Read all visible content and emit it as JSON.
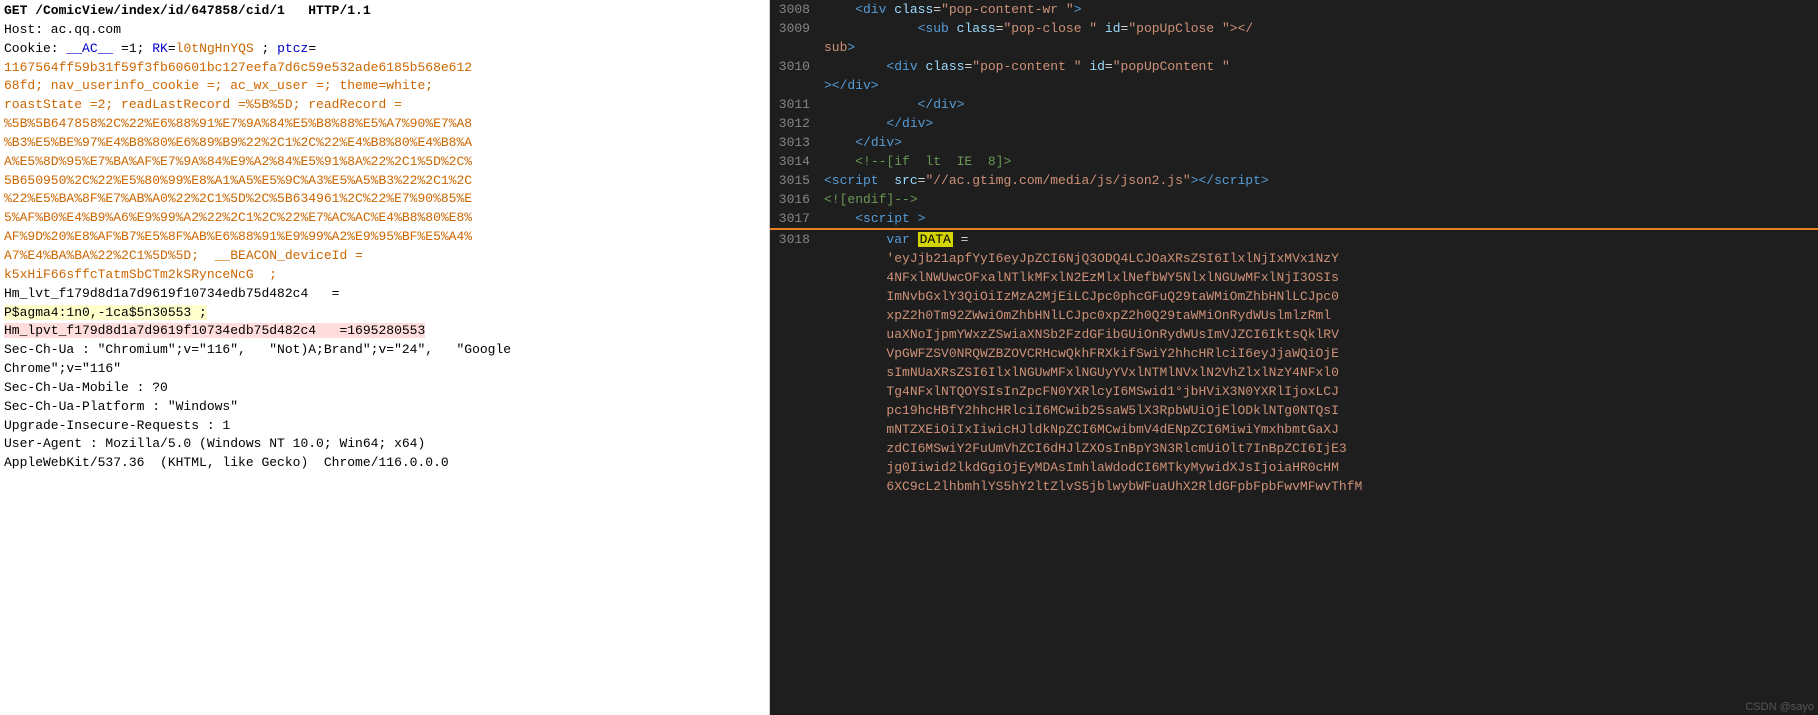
{
  "left": {
    "lines": [
      {
        "text": "GET /ComicView/index/id/647858/cid/1   HTTP/1.1",
        "type": "request"
      },
      {
        "text": "Host: ac.qq.com",
        "type": "header"
      },
      {
        "text": "Cookie: __AC__=1; RK=l0tNgHnYQS; ptcz=",
        "type": "header"
      },
      {
        "text": "1167564ff59b31f59f3fb60601bc127eefa7d6c59e532ade6185b568e612",
        "type": "cookie-val"
      },
      {
        "text": "68fd; nav_userinfo_cookie =; ac_wx_user =; theme=white;",
        "type": "cookie-val"
      },
      {
        "text": "roastState =2; readLastRecord =%5B%5D; readRecord =",
        "type": "cookie-val"
      },
      {
        "text": "%5B%5B647858%2C%22%E6%88%91%E7%9A%84%E5%B8%88%E5%A7%90%E7%A8",
        "type": "cookie-val"
      },
      {
        "text": "%B3%E5%BE%97%E4%B8%80%E6%89%B9%22%2C1%2C%22%E4%B8%80%E4%B8%A",
        "type": "cookie-val"
      },
      {
        "text": "A%E5%8D%95%E7%BA%AF%E7%9A%84%E9%A2%84%E5%91%8A%22%2C1%5D%2C%",
        "type": "cookie-val"
      },
      {
        "text": "5B650950%2C%22%E5%80%99%E8%A1%A5%E5%9C%A3%E5%A5%B3%22%2C1%2C",
        "type": "cookie-val"
      },
      {
        "text": "%22%E5%BA%8F%E7%AB%A0%22%2C1%5D%2C%5B634961%2C%22%E7%90%85%E",
        "type": "cookie-val"
      },
      {
        "text": "5%AF%B0%E4%B9%A6%E9%99%A2%22%2C1%2C%22%E7%AC%AC%E4%B8%80%E8%",
        "type": "cookie-val"
      },
      {
        "text": "AF%9D%20%E8%AF%B7%E5%8F%AB%E6%88%91%E9%99%A2%E9%95%BF%E5%A4%",
        "type": "cookie-val"
      },
      {
        "text": "A7%E4%BA%BA%22%2C1%5D%5D; __BEACON_deviceId =",
        "type": "cookie-val"
      },
      {
        "text": "k5xHiF66sffcTatmSbCTm2kSRynceNcG ;",
        "type": "cookie-val"
      },
      {
        "text": "Hm_lvt_f179d8d1a7d9619f10734edb75d482c4   =",
        "type": "header"
      },
      {
        "text": "P$agma4:1n0,-1ca$5n30553 ;",
        "type": "highlight-line"
      },
      {
        "text": "Hm_lpvt_f179d8d1a7d9619f10734edb75d482c4   =1695280553",
        "type": "highlight-line2"
      },
      {
        "text": "Sec-Ch-Ua : \"Chromium\";v=\"116\",  \"Not)A;Brand\";v=\"24\",  \"Google",
        "type": "header"
      },
      {
        "text": "Chrome\";v=\"116\"",
        "type": "header"
      },
      {
        "text": "Sec-Ch-Ua-Mobile : ?0",
        "type": "header"
      },
      {
        "text": "Sec-Ch-Ua-Platform : \"Windows\"",
        "type": "header"
      },
      {
        "text": "Upgrade-Insecure-Requests : 1",
        "type": "header"
      },
      {
        "text": "User-Agent : Mozilla/5.0 (Windows NT 10.0; Win64; x64)",
        "type": "header"
      },
      {
        "text": "AppleWebKit/537.36  (KHTML, like Gecko)  Chrome/116.0.0.0",
        "type": "header"
      }
    ]
  },
  "right": {
    "lines": [
      {
        "num": "3008",
        "html_raw": "    <span class='tag'>&lt;div</span> <span class='attr'>class</span>=<span class='val'>\"pop-content-wr \"</span><span class='tag'>&gt;</span>"
      },
      {
        "num": "3009",
        "html_raw": "            <span class='tag'>&lt;sub</span> <span class='attr'>class</span>=<span class='val'>\"pop-close \"</span> <span class='attr'>id</span>=<span class='val'>\"popUpClose \"</span><span class='tag'>&gt;&lt;/</span>"
      },
      {
        "num": "",
        "html_raw": "<span class='tag'>sub</span><span class='tag'>&gt;</span>"
      },
      {
        "num": "3010",
        "html_raw": "        <span class='tag'>&lt;div</span> <span class='attr'>class</span>=<span class='val'>\"pop-content \"</span> <span class='attr'>id</span>=<span class='val'>\"popUpContent \"</span>"
      },
      {
        "num": "",
        "html_raw": "<span class='tag'>&gt;&lt;/div&gt;</span>"
      },
      {
        "num": "3011",
        "html_raw": "            <span class='tag'>&lt;/div&gt;</span>"
      },
      {
        "num": "3012",
        "html_raw": "        <span class='tag'>&lt;/div&gt;</span>"
      },
      {
        "num": "3013",
        "html_raw": "    <span class='tag'>&lt;/div&gt;</span>"
      },
      {
        "num": "3014",
        "html_raw": "    <span class='kw-green'>&lt;!--[if  lt  IE  8]&gt;</span>"
      },
      {
        "num": "3015",
        "html_raw": "<span class='tag'>&lt;script</span>  <span class='attr'>src</span>=<span class='val'>\"//<span style='color:#ce9178'>ac.gtimg.com/media/js/json2.js</span>\"</span><span class='tag'>&gt;&lt;/script&gt;</span>"
      },
      {
        "num": "3016",
        "html_raw": "<span class='kw-green'>&lt;![endif]--&gt;</span>"
      },
      {
        "num": "3017",
        "html_raw": "    <span class='tag'>&lt;script</span> <span class='tag'>&gt;</span>"
      },
      {
        "num": "3018",
        "html_raw": "        <span class='kw-blue'>var</span> <span class='highlight-yellow' style='background:#d4d400;color:#000;'>DATA</span> <span class='text-white'>=</span>"
      },
      {
        "num": "",
        "html_raw": "        <span class='val'>'eyJjb21apfYyI6eyJpZCI6NjQ3ODQ4LCJOaXRsZSI6IlxlNjIxMVx1NzY</span>"
      },
      {
        "num": "",
        "html_raw": "        <span class='val'>4NFxlNWUwcOFxalNTlkMFxlN2EzMlxlNefbWY5NlxlNGUwMFxlNjI3OSIs</span>"
      },
      {
        "num": "",
        "html_raw": "        <span class='val'>ImNvbGxlY3QiOiIzMzA2MjEiLCJpc0phcGFuQ29taWMiOmZhbHNlLCJpc0</span>"
      },
      {
        "num": "",
        "html_raw": "        <span class='val'>xpZ2h0Tm92ZWwiOmZhbHNlLCJpc0xpZ2h0Q29taWMiOnRydWUslmlzRml</span>"
      },
      {
        "num": "",
        "html_raw": "        <span class='val'>uaXNoIjpmYWxzZSwiaXNSb2FzdGFibGUiOnRydWUsImVJZCI6IktsQklRV</span>"
      },
      {
        "num": "",
        "html_raw": "        <span class='val'>VpGWFZSV0NRQWZBZOVCRHcwQkhFRXkifSwiY2hhcHRlciI6eyJjaWQiOjE</span>"
      },
      {
        "num": "",
        "html_raw": "        <span class='val'>sImNUaXRsZSI6IlxlNGUwMFxlNGUyYVxlNTMlNVxlN2VhZlxlNzY4NFxl0</span>"
      },
      {
        "num": "",
        "html_raw": "        <span class='val'>Tg4NFxlNTQOYSIsInZpcFN0YXRlcyI6MSwid1°jbHViX3N0YXRlIjoxLCJ</span>"
      },
      {
        "num": "",
        "html_raw": "        <span class='val'>pc19hcHBfY2hhcHRlciI6MCwib25saW5lX3RpbWUiOjElODklNTg0NTQsI</span>"
      },
      {
        "num": "",
        "html_raw": "        <span class='val'>mNTZXEiOiIxIiwicHJldkNpZCI6MCwibmV4dENpZCI6MiwiYmxhbmtGaXJ</span>"
      },
      {
        "num": "",
        "html_raw": "        <span class='val'>zdCI6MSwiY2FuUmVhZCI6dHJlZXOsInBpY3N3RlcmUiOlt7InBpZCI6IjE3</span>"
      },
      {
        "num": "",
        "html_raw": "        <span class='val'>jg0Iiwid2lkdGgiOjEyMDAsImhlaWdodCI6MTkyMywidXJsIjoiaHR0cHM</span>"
      },
      {
        "num": "",
        "html_raw": "        <span class='val'>6XC9cL2lhbmhlYS5hY2ltZlvS5jblwybWFuaUhX2RldGFpbFpbFwvMFwvThfM</span>"
      }
    ],
    "watermark": "CSDN @sayo"
  }
}
